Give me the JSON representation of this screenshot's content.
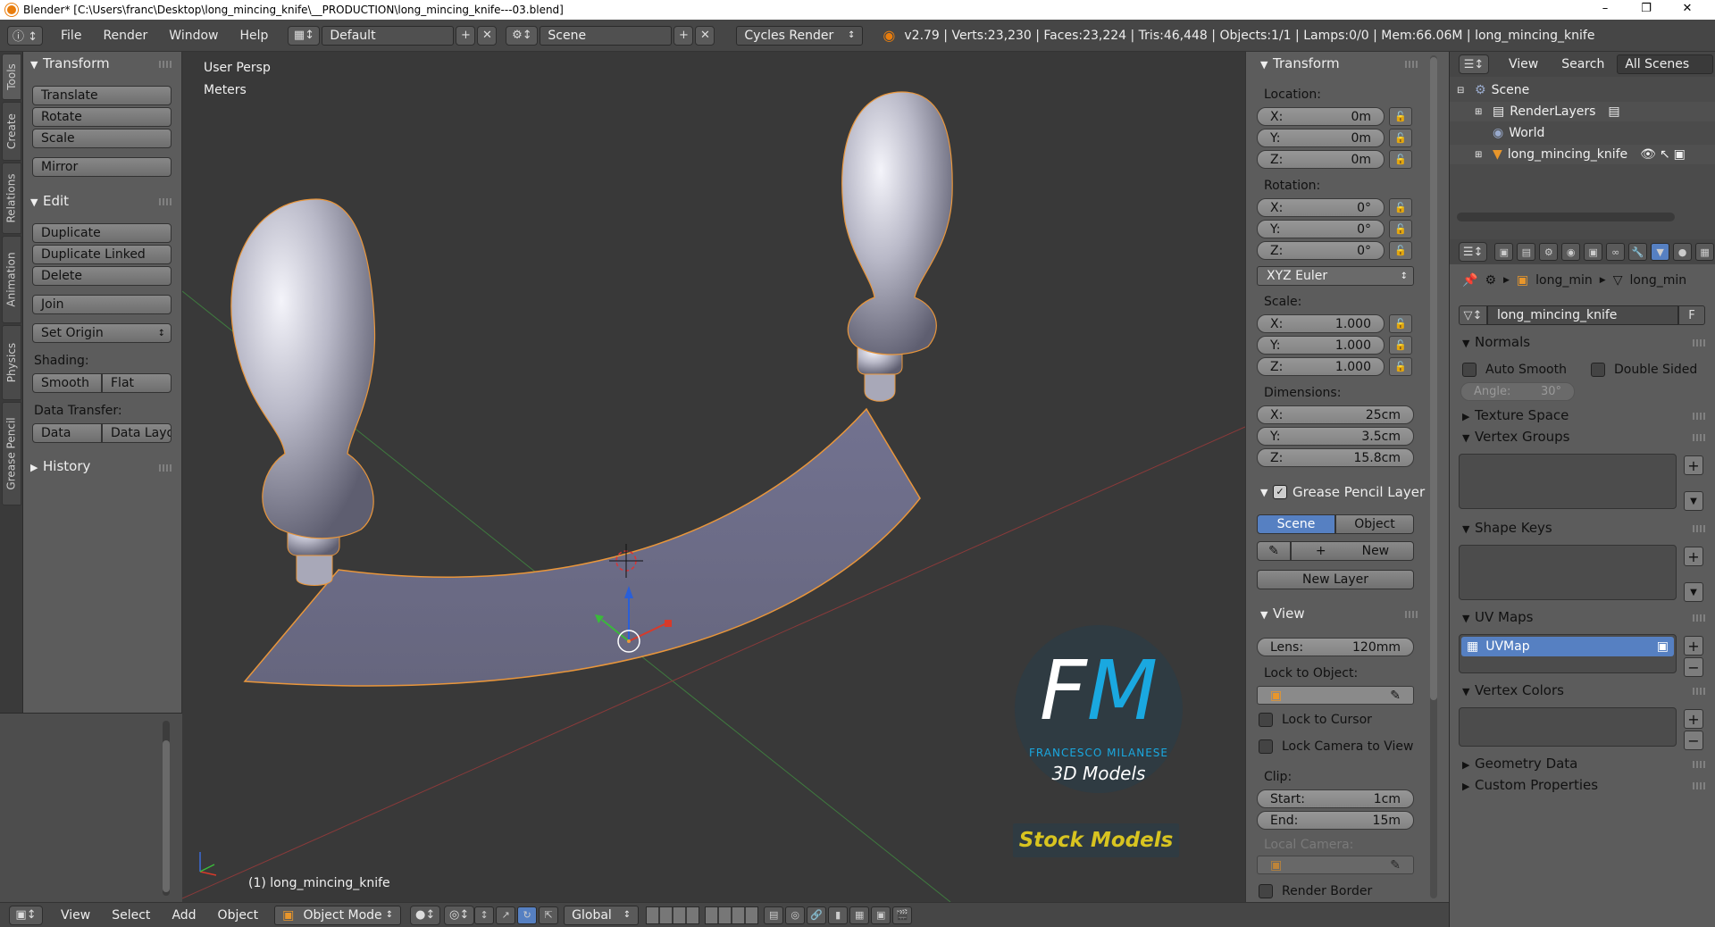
{
  "window": {
    "title": "Blender* [C:\\Users\\franc\\Desktop\\long_mincing_knife\\__PRODUCTION\\long_mincing_knife---03.blend]",
    "controls": [
      "–",
      "❐",
      "✕"
    ]
  },
  "topbar": {
    "menus": [
      "File",
      "Render",
      "Window",
      "Help"
    ],
    "screen_layout": "Default",
    "scene": "Scene",
    "render_engine": "Cycles Render",
    "stats": "v2.79 | Verts:23,230 | Faces:23,224 | Tris:46,448 | Objects:1/1 | Lamps:0/0 | Mem:66.06M | long_mincing_knife"
  },
  "left_tabs": [
    "Tools",
    "Create",
    "Relations",
    "Animation",
    "Physics",
    "Grease Pencil"
  ],
  "tool_shelf": {
    "transform": {
      "title": "Transform",
      "buttons": [
        "Translate",
        "Rotate",
        "Scale",
        "Mirror"
      ]
    },
    "edit": {
      "title": "Edit",
      "buttons": [
        "Duplicate",
        "Duplicate Linked",
        "Delete",
        "Join"
      ],
      "set_origin": "Set Origin",
      "shading_label": "Shading:",
      "shading_buttons": [
        "Smooth",
        "Flat"
      ],
      "data_transfer_label": "Data Transfer:",
      "data_transfer_buttons": [
        "Data",
        "Data Layo"
      ]
    },
    "history_title": "History"
  },
  "viewport": {
    "view_name": "User Persp",
    "units": "Meters",
    "object_label": "(1) long_mincing_knife",
    "watermark": {
      "logo": "FM",
      "author": "FRANCESCO MILANESE",
      "tagline": "3D Models",
      "banner": "Stock Models"
    },
    "colors": {
      "background": "#393939",
      "blade": "#6b6b86",
      "outline": "#f0a040"
    }
  },
  "n_panel": {
    "transform_title": "Transform",
    "location_label": "Location:",
    "location": [
      {
        "axis": "X:",
        "value": "0m"
      },
      {
        "axis": "Y:",
        "value": "0m"
      },
      {
        "axis": "Z:",
        "value": "0m"
      }
    ],
    "rotation_label": "Rotation:",
    "rotation": [
      {
        "axis": "X:",
        "value": "0°"
      },
      {
        "axis": "Y:",
        "value": "0°"
      },
      {
        "axis": "Z:",
        "value": "0°"
      }
    ],
    "rotation_mode": "XYZ Euler",
    "scale_label": "Scale:",
    "scale": [
      {
        "axis": "X:",
        "value": "1.000"
      },
      {
        "axis": "Y:",
        "value": "1.000"
      },
      {
        "axis": "Z:",
        "value": "1.000"
      }
    ],
    "dimensions_label": "Dimensions:",
    "dimensions": [
      {
        "axis": "X:",
        "value": "25cm"
      },
      {
        "axis": "Y:",
        "value": "3.5cm"
      },
      {
        "axis": "Z:",
        "value": "15.8cm"
      }
    ],
    "grease_pencil_title": "Grease Pencil Layer",
    "gp_tabs": [
      "Scene",
      "Object"
    ],
    "gp_new": "New",
    "gp_new_layer": "New Layer",
    "view_title": "View",
    "lens_label": "Lens:",
    "lens_value": "120mm",
    "lock_to_object_label": "Lock to Object:",
    "lock_to_cursor": "Lock to Cursor",
    "lock_camera_to_view": "Lock Camera to View",
    "clip_label": "Clip:",
    "clip_start_label": "Start:",
    "clip_start": "1cm",
    "clip_end_label": "End:",
    "clip_end": "15m",
    "local_camera_label": "Local Camera:",
    "render_border": "Render Border"
  },
  "outliner": {
    "menus": [
      "View",
      "Search"
    ],
    "filter": "All Scenes",
    "items": [
      "Scene",
      "RenderLayers",
      "World",
      "long_mincing_knife"
    ]
  },
  "properties": {
    "breadcrumb": [
      "long_min",
      "long_min"
    ],
    "mesh_name": "long_mincing_knife",
    "fake_user": "F",
    "normals_title": "Normals",
    "auto_smooth": "Auto Smooth",
    "double_sided": "Double Sided",
    "angle_label": "Angle:",
    "angle_value": "30°",
    "sections": [
      "Texture Space",
      "Vertex Groups",
      "Shape Keys",
      "UV Maps",
      "Vertex Colors",
      "Geometry Data",
      "Custom Properties"
    ],
    "uv_map_name": "UVMap"
  },
  "bottombar": {
    "menus": [
      "View",
      "Select",
      "Add",
      "Object"
    ],
    "mode": "Object Mode",
    "orientation": "Global"
  }
}
